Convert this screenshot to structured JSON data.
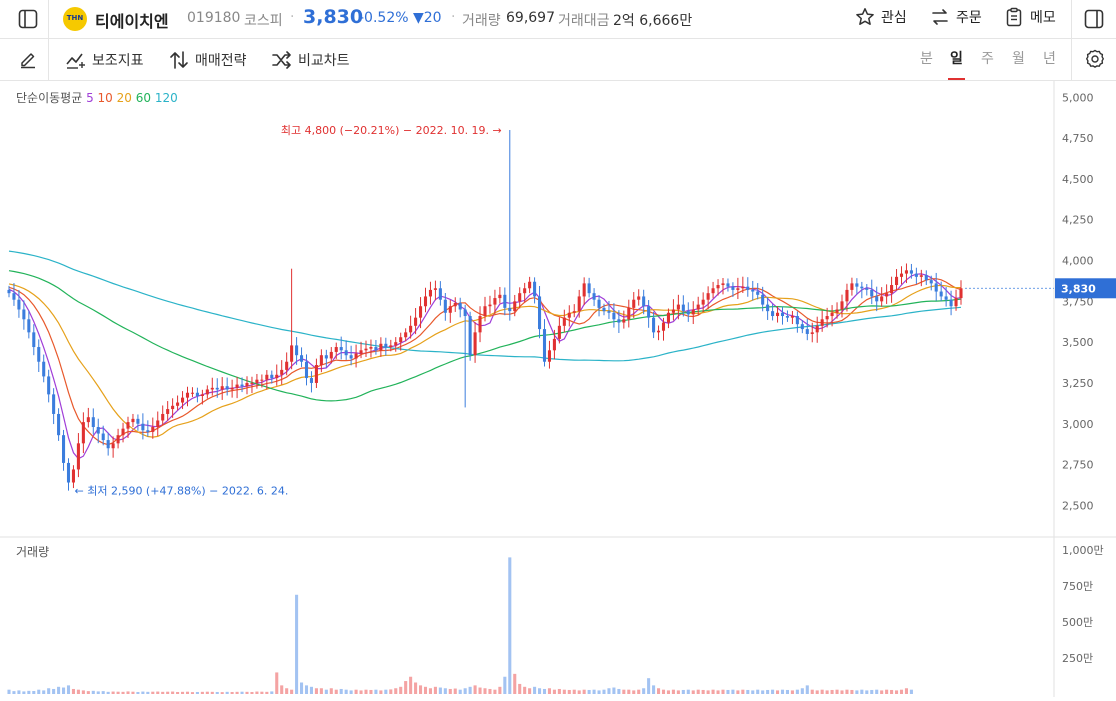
{
  "header": {
    "stock_name": "티에이치엔",
    "code": "019180",
    "market": "코스피",
    "price": "3,830",
    "change_pct": "-0.52%",
    "change_abs": "▼20",
    "volume_label": "거래량",
    "volume": "69,697",
    "amount_label": "거래대금",
    "amount": "2억 6,666만",
    "actions": {
      "watch": "관심",
      "order": "주문",
      "memo": "메모"
    },
    "logo_text": "THN"
  },
  "toolbar": {
    "indicators": "보조지표",
    "strategy": "매매전략",
    "compare": "비교차트",
    "periods": [
      "분",
      "일",
      "주",
      "월",
      "년"
    ],
    "active_period": "일"
  },
  "chart_data": {
    "type": "candlestick",
    "ma_title": "단순이동평균",
    "ma_periods": [
      "5",
      "10",
      "20",
      "60",
      "120"
    ],
    "ma_colors": [
      "#a03ed8",
      "#e8592c",
      "#e6a11b",
      "#22b35a",
      "#2bb3c8"
    ],
    "up_color": "#e03131",
    "down_color": "#3b7ddd",
    "price_ticks": [
      "5,000",
      "4,750",
      "4,500",
      "4,250",
      "4,000",
      "3,750",
      "3,500",
      "3,250",
      "3,000",
      "2,750",
      "2,500"
    ],
    "price_tick_values": [
      5000,
      4750,
      4500,
      4250,
      4000,
      3750,
      3500,
      3250,
      3000,
      2750,
      2500
    ],
    "ylim": [
      2300,
      5100
    ],
    "current_price_label": "3,830",
    "current_price": 3830,
    "high_annotation": "최고 4,800 (−20.21%) − 2022. 10. 19.",
    "high_value": 4800,
    "low_annotation": "← 최저 2,590 (+47.88%) − 2022. 6. 24.",
    "low_value": 2590,
    "volume_title": "거래량",
    "volume_ticks": [
      "1,000만",
      "750만",
      "500만",
      "250만"
    ],
    "volume_tick_values": [
      10000000,
      7500000,
      5000000,
      2500000
    ],
    "closes": [
      3800,
      3760,
      3700,
      3640,
      3560,
      3470,
      3380,
      3290,
      3180,
      3060,
      2930,
      2760,
      2640,
      2720,
      2880,
      3010,
      3040,
      2980,
      2940,
      2900,
      2850,
      2880,
      2930,
      2970,
      3010,
      3030,
      3000,
      2960,
      2950,
      2980,
      3020,
      3060,
      3090,
      3110,
      3130,
      3160,
      3190,
      3190,
      3170,
      3180,
      3210,
      3220,
      3210,
      3230,
      3210,
      3220,
      3240,
      3230,
      3250,
      3250,
      3270,
      3270,
      3300,
      3280,
      3300,
      3330,
      3380,
      3480,
      3420,
      3380,
      3280,
      3250,
      3360,
      3420,
      3400,
      3440,
      3470,
      3450,
      3420,
      3400,
      3430,
      3450,
      3460,
      3470,
      3450,
      3490,
      3470,
      3480,
      3500,
      3530,
      3560,
      3600,
      3650,
      3720,
      3780,
      3820,
      3830,
      3760,
      3680,
      3720,
      3740,
      3700,
      3660,
      3420,
      3560,
      3660,
      3720,
      3730,
      3770,
      3790,
      3710,
      3690,
      3750,
      3800,
      3830,
      3870,
      3780,
      3580,
      3380,
      3450,
      3520,
      3600,
      3650,
      3680,
      3690,
      3780,
      3860,
      3800,
      3760,
      3710,
      3690,
      3680,
      3640,
      3620,
      3640,
      3710,
      3760,
      3780,
      3720,
      3650,
      3560,
      3570,
      3620,
      3680,
      3700,
      3730,
      3690,
      3670,
      3700,
      3730,
      3760,
      3800,
      3830,
      3850,
      3860,
      3840,
      3820,
      3830,
      3840,
      3820,
      3810,
      3790,
      3730,
      3690,
      3660,
      3680,
      3660,
      3650,
      3660,
      3610,
      3580,
      3550,
      3560,
      3600,
      3640,
      3660,
      3680,
      3700,
      3750,
      3820,
      3860,
      3840,
      3830,
      3820,
      3780,
      3750,
      3780,
      3800,
      3850,
      3900,
      3920,
      3940,
      3920,
      3900,
      3910,
      3880,
      3860,
      3810,
      3780,
      3760,
      3720,
      3770,
      3830
    ],
    "volumes": [
      300000,
      200000,
      250000,
      180000,
      220000,
      210000,
      300000,
      250000,
      400000,
      350000,
      500000,
      450000,
      600000,
      350000,
      300000,
      250000,
      200000,
      220000,
      180000,
      200000,
      150000,
      170000,
      160000,
      150000,
      180000,
      160000,
      140000,
      170000,
      150000,
      160000,
      170000,
      150000,
      160000,
      170000,
      140000,
      150000,
      160000,
      130000,
      140000,
      150000,
      160000,
      150000,
      140000,
      130000,
      150000,
      140000,
      150000,
      160000,
      150000,
      140000,
      170000,
      160000,
      150000,
      180000,
      1500000,
      600000,
      400000,
      300000,
      6900000,
      800000,
      600000,
      500000,
      400000,
      400000,
      300000,
      400000,
      300000,
      350000,
      300000,
      250000,
      300000,
      250000,
      300000,
      280000,
      300000,
      250000,
      300000,
      320000,
      400000,
      500000,
      900000,
      1200000,
      800000,
      600000,
      500000,
      400000,
      500000,
      450000,
      400000,
      350000,
      380000,
      300000,
      400000,
      500000,
      600000,
      450000,
      400000,
      350000,
      300000,
      500000,
      1200000,
      9500000,
      1400000,
      700000,
      500000,
      400000,
      500000,
      400000,
      350000,
      400000,
      300000,
      350000,
      300000,
      280000,
      300000,
      250000,
      300000,
      280000,
      300000,
      250000,
      300000,
      400000,
      450000,
      350000,
      300000,
      300000,
      250000,
      300000,
      400000,
      1100000,
      600000,
      400000,
      300000,
      250000,
      300000,
      250000,
      280000,
      300000,
      250000,
      300000,
      280000,
      250000,
      300000,
      250000,
      300000,
      280000,
      300000,
      250000,
      300000,
      280000,
      250000,
      300000,
      250000,
      280000,
      300000,
      250000,
      300000,
      280000,
      250000,
      300000,
      400000,
      600000,
      300000,
      250000,
      300000,
      250000,
      280000,
      300000,
      250000,
      300000,
      280000,
      250000,
      300000,
      250000,
      280000,
      300000,
      250000,
      300000,
      280000,
      250000,
      300000,
      400000,
      300000
    ]
  }
}
